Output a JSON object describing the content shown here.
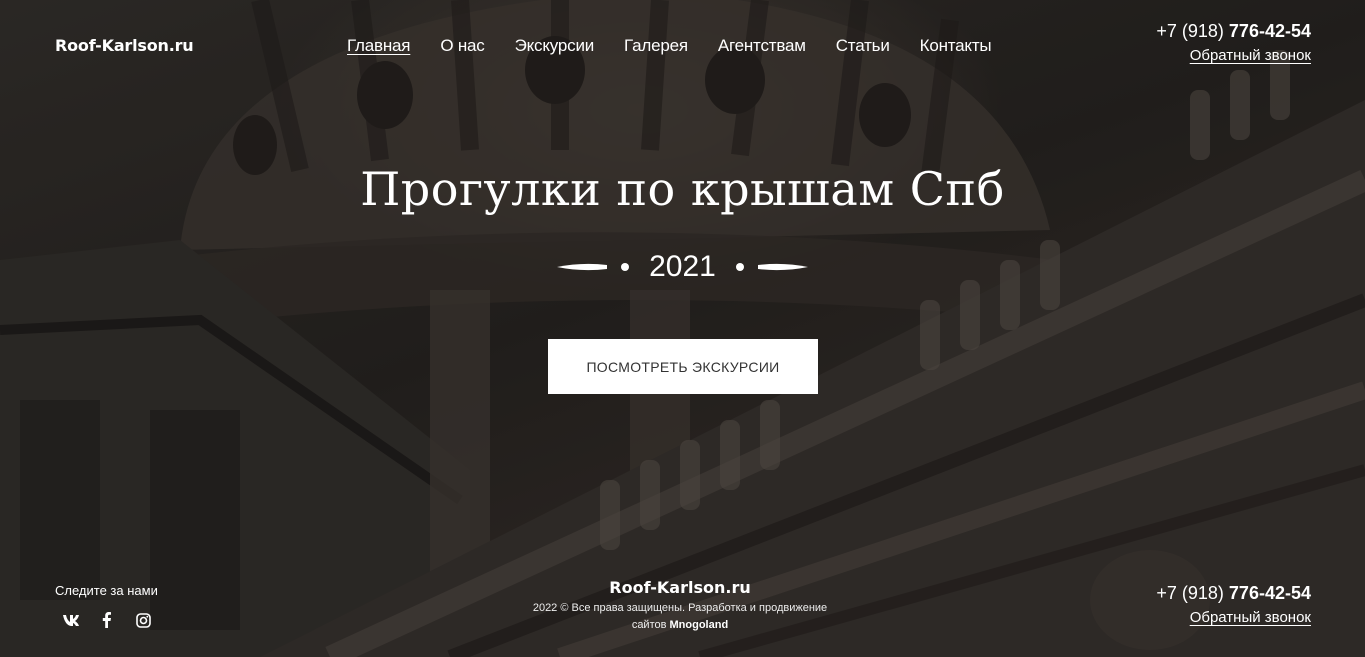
{
  "header": {
    "logo": "Roof-Karlson.ru",
    "nav": [
      {
        "label": "Главная",
        "active": true
      },
      {
        "label": "О нас"
      },
      {
        "label": "Экскурсии"
      },
      {
        "label": "Галерея"
      },
      {
        "label": "Агентствам"
      },
      {
        "label": "Статьи"
      },
      {
        "label": "Контакты"
      }
    ],
    "phone_code": "+7 (918)",
    "phone_number": "776-42-54",
    "callback_label": "Обратный звонок"
  },
  "hero": {
    "title": "Прогулки по крышам Спб",
    "year": "2021",
    "cta_label": "ПОСМОТРЕТЬ ЭКСКУРСИИ"
  },
  "footer": {
    "follow_label": "Следите за нами",
    "socials": [
      {
        "icon": "vk-icon"
      },
      {
        "icon": "facebook-icon"
      },
      {
        "icon": "instagram-icon"
      }
    ],
    "logo": "Roof-Karlson.ru",
    "copyright_text": "2022 © Все права защищены. Разработка и продвижение сайтов",
    "developer": "Mnogoland",
    "phone_code": "+7 (918)",
    "phone_number": "776-42-54",
    "callback_label": "Обратный звонок"
  },
  "colors": {
    "cta_bg": "#ffffff",
    "cta_text": "#333333",
    "overlay": "#2f2b28"
  }
}
